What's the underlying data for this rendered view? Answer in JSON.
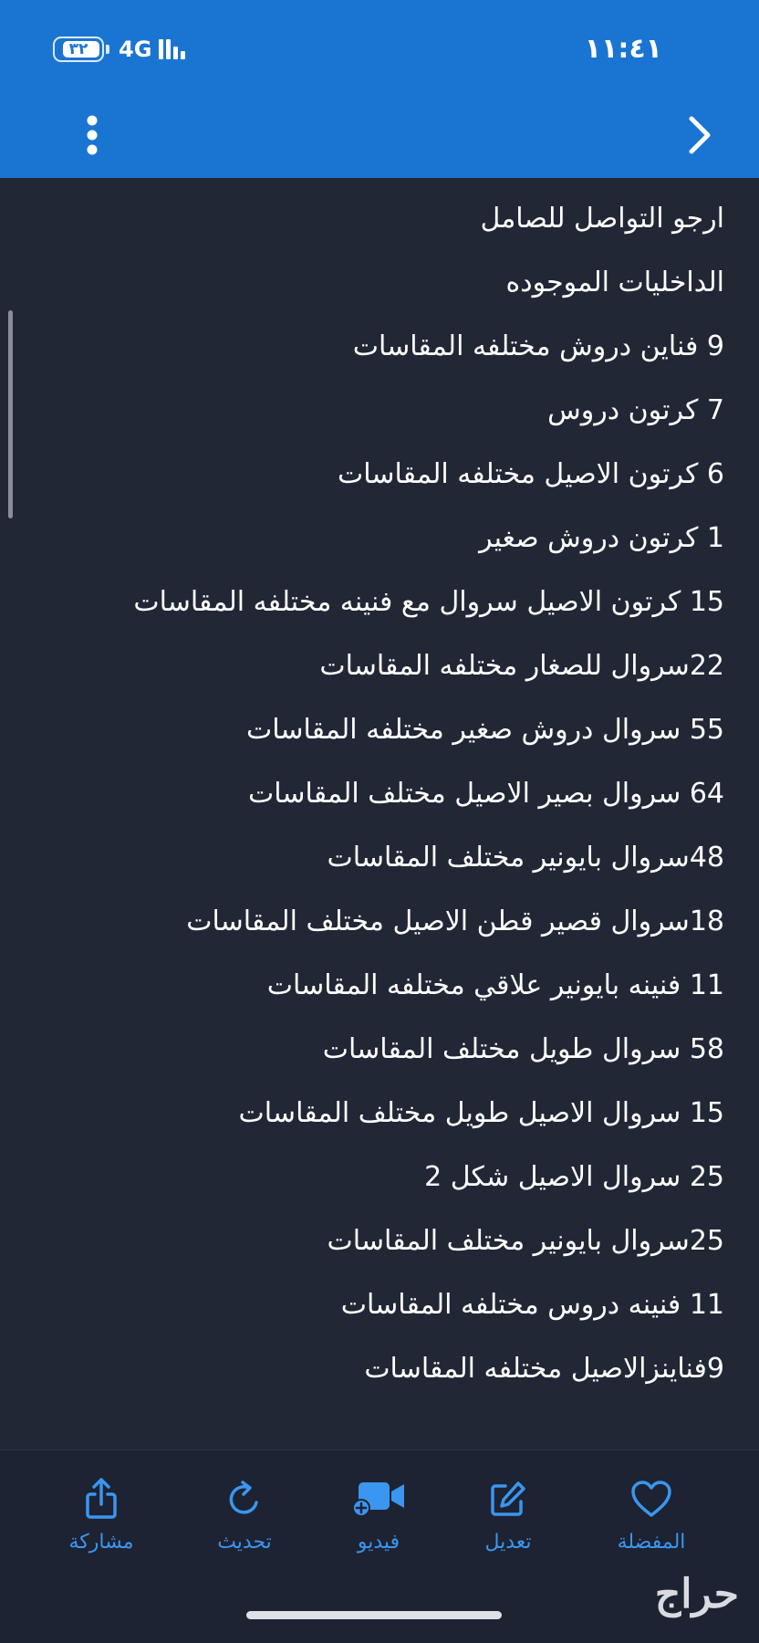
{
  "status_bar": {
    "time": "١١:٤١",
    "battery": "٣٢",
    "network": "4G"
  },
  "header": {
    "back_icon": "chevron-right-icon",
    "menu_icon": "more-vertical-icon",
    "background_color": "#1a75d2"
  },
  "content": {
    "lines": [
      "ارجو التواصل للصامل",
      "الداخليات الموجوده",
      "9 فناين دروش مختلفه المقاسات",
      "7 كرتون دروس",
      "6 كرتون الاصيل مختلفه المقاسات",
      "1 كرتون دروش صغير",
      "15 كرتون الاصيل سروال مع فنينه مختلفه المقاسات",
      "22سروال للصغار مختلفه المقاسات",
      "55 سروال دروش صغير مختلفه المقاسات",
      "64 سروال بصير الاصيل مختلف المقاسات",
      "48سروال بايونير مختلف المقاسات",
      "18سروال قصير قطن الاصيل مختلف المقاسات",
      "11 فنينه بايونير علاقي مختلفه المقاسات",
      "58 سروال طويل مختلف المقاسات",
      "15 سروال الاصيل طويل مختلف المقاسات",
      "25 سروال الاصيل شكل 2",
      "25سروال بايونير مختلف المقاسات",
      "11 فنينه دروس مختلفه المقاسات",
      "9فناينزالاصيل مختلفه المقاسات"
    ]
  },
  "toolbar": {
    "favorite": {
      "label": "المفضلة",
      "icon": "heart-icon"
    },
    "edit": {
      "label": "تعديل",
      "icon": "edit-icon"
    },
    "video": {
      "label": "فيديو",
      "icon": "video-add-icon"
    },
    "refresh": {
      "label": "تحديث",
      "icon": "refresh-icon"
    },
    "share": {
      "label": "مشاركة",
      "icon": "share-icon"
    },
    "accent_color": "#3a96f0"
  },
  "brand": {
    "logo_text": "حراج"
  }
}
